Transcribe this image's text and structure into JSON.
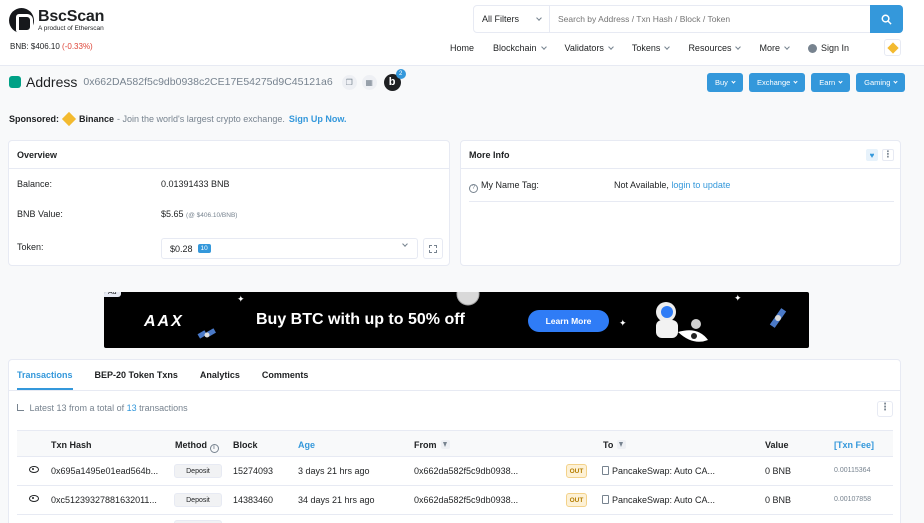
{
  "brand": {
    "name": "BscScan",
    "tagline": "A product of Etherscan"
  },
  "price": {
    "label": "BNB: $406.10",
    "change": "(-0.33%)"
  },
  "search": {
    "filter_label": "All Filters",
    "placeholder": "Search by Address / Txn Hash / Block / Token"
  },
  "nav": {
    "home": "Home",
    "blockchain": "Blockchain",
    "validators": "Validators",
    "tokens": "Tokens",
    "resources": "Resources",
    "more": "More",
    "signin": "Sign In"
  },
  "address": {
    "label": "Address",
    "hash": "0x662DA582f5c9db0938c2CE17E54275d9C45121a6",
    "b_badge_count": "2"
  },
  "header_buttons": {
    "buy": "Buy",
    "exchange": "Exchange",
    "earn": "Earn",
    "gaming": "Gaming"
  },
  "sponsor": {
    "label": "Sponsored:",
    "name": "Binance",
    "text": "- Join the world's largest crypto exchange.",
    "cta": "Sign Up Now."
  },
  "overview": {
    "title": "Overview",
    "balance_label": "Balance:",
    "balance_value": "0.01391433 BNB",
    "bnb_value_label": "BNB Value:",
    "bnb_value": "$5.65",
    "bnb_value_note": "(@ $406.10/BNB)",
    "token_label": "Token:",
    "token_value": "$0.28",
    "token_count": "10"
  },
  "more_info": {
    "title": "More Info",
    "name_tag_label": "My Name Tag:",
    "name_tag_value": "Not Available,",
    "name_tag_link": "login to update"
  },
  "ad": {
    "tag": "Ad",
    "logo": "AAX",
    "headline": "Buy BTC with up to 50% off",
    "button": "Learn More"
  },
  "tabs": [
    "Transactions",
    "BEP-20 Token Txns",
    "Analytics",
    "Comments"
  ],
  "tx_summary": {
    "prefix": "Latest 13 from a total of",
    "count": "13",
    "suffix": "transactions"
  },
  "table": {
    "headers": {
      "hash": "Txn Hash",
      "method": "Method",
      "block": "Block",
      "age": "Age",
      "from": "From",
      "to": "To",
      "value": "Value",
      "fee": "[Txn Fee]"
    },
    "rows": [
      {
        "hash": "0x695a1495e01ead564b...",
        "method": "Deposit",
        "block": "15274093",
        "age": "3 days 21 hrs ago",
        "from": "0x662da582f5c9db0938...",
        "direction": "OUT",
        "to": "PancakeSwap: Auto CA...",
        "value": "0 BNB",
        "fee": "0.00115364"
      },
      {
        "hash": "0xc51239327881632011...",
        "method": "Deposit",
        "block": "14383460",
        "age": "34 days 21 hrs ago",
        "from": "0x662da582f5c9db0938...",
        "direction": "OUT",
        "to": "PancakeSwap: Auto CA...",
        "value": "0 BNB",
        "fee": "0.00107858"
      }
    ]
  }
}
